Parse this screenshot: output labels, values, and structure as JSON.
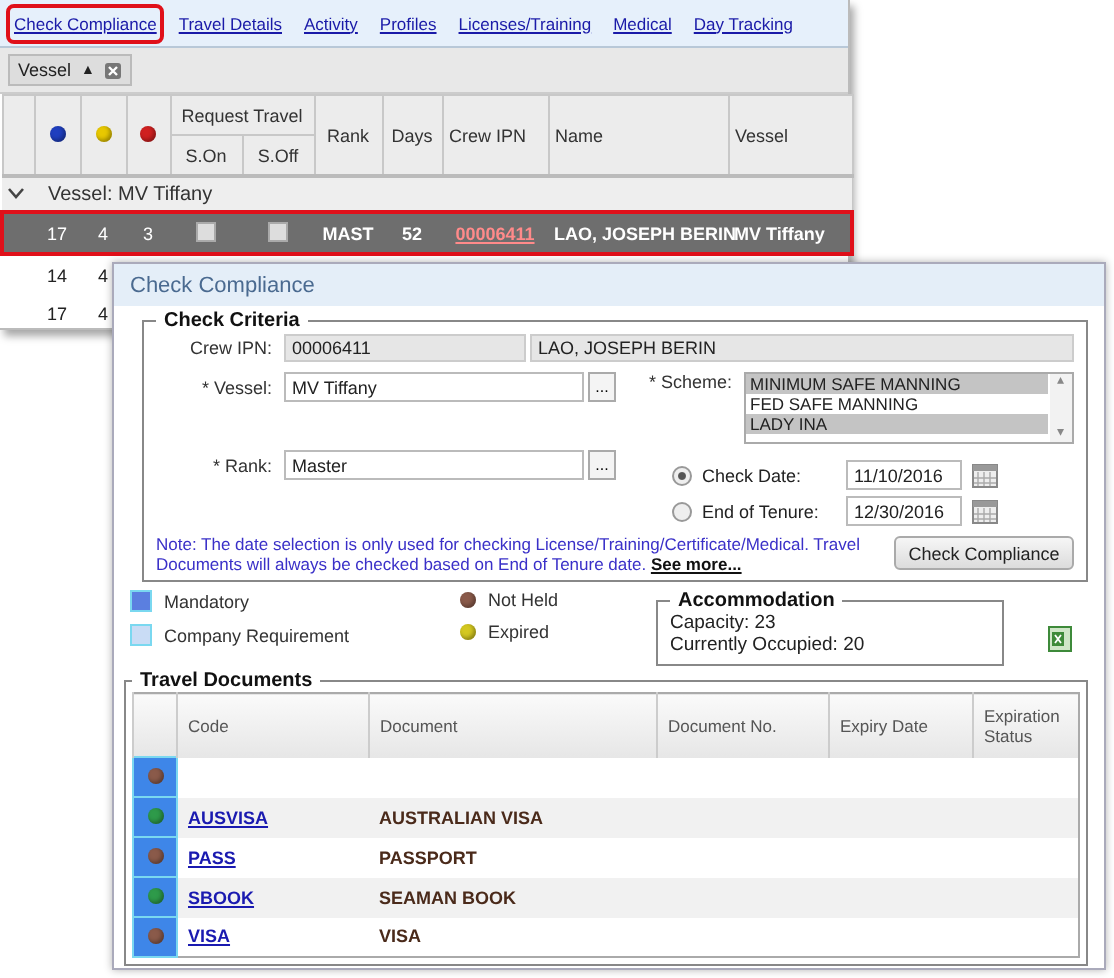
{
  "tabs": [
    {
      "label": "Check Compliance",
      "selected": true
    },
    {
      "label": "Travel Details",
      "selected": false
    },
    {
      "label": "Activity",
      "selected": false
    },
    {
      "label": "Profiles",
      "selected": false
    },
    {
      "label": "Licenses/Training",
      "selected": false
    },
    {
      "label": "Medical",
      "selected": false
    },
    {
      "label": "Day Tracking",
      "selected": false
    }
  ],
  "group_chip": {
    "label": "Vessel",
    "sort": "▲"
  },
  "grid": {
    "status_columns": [
      {
        "color": "#1f3fbf"
      },
      {
        "color": "#e8c800"
      },
      {
        "color": "#d02020"
      }
    ],
    "request_travel": "Request Travel",
    "sub_columns": [
      "S.On",
      "S.Off"
    ],
    "columns": [
      "Rank",
      "Days",
      "Crew IPN",
      "Name",
      "Vessel"
    ],
    "group": {
      "label": "Vessel: MV Tiffany",
      "expanded": true
    },
    "rows": [
      {
        "counts": [
          "17",
          "4",
          "3"
        ],
        "sign_on": false,
        "sign_off": false,
        "rank": "MAST",
        "days": "52",
        "crew_ipn": "00006411",
        "name": "LAO, JOSEPH BERIN",
        "vessel": "MV Tiffany",
        "selected": true
      },
      {
        "counts": [
          "14",
          "4"
        ],
        "selected": false
      },
      {
        "counts": [
          "17",
          "4"
        ],
        "selected": false
      }
    ]
  },
  "dialog": {
    "title": "Check Compliance",
    "criteria": {
      "legend": "Check Criteria",
      "crew_ipn_label": "Crew IPN:",
      "crew_ipn": "00006411",
      "crew_name": "LAO, JOSEPH BERIN",
      "vessel_label": "* Vessel:",
      "vessel": "MV Tiffany",
      "vessel_browse": "...",
      "rank_label": "* Rank:",
      "rank": "Master",
      "rank_browse": "...",
      "scheme_label": "* Scheme:",
      "scroll_up": "▴",
      "scroll_down": "▾",
      "schemes": [
        {
          "label": "MINIMUM SAFE MANNING",
          "selected": true
        },
        {
          "label": "FED SAFE MANNING",
          "selected": false
        },
        {
          "label": "LADY INA",
          "selected": true
        }
      ],
      "date_options": [
        {
          "label": "Check Date:",
          "selected": true,
          "value": "11/10/2016"
        },
        {
          "label": "End of Tenure:",
          "selected": false,
          "value": "12/30/2016"
        }
      ],
      "note": "Note: The date selection is only used for checking License/Training/Certificate/Medical. Travel Documents will always be checked based on End of Tenure date.",
      "see_more": "See more...",
      "button": "Check Compliance"
    },
    "legend_left": [
      {
        "label": "Mandatory",
        "color": "#5b7fe0"
      },
      {
        "label": "Company Requirement",
        "color": "#c9dcf5"
      }
    ],
    "legend_right": [
      {
        "label": "Not Held",
        "color": "#8a5a4a"
      },
      {
        "label": "Expired",
        "color": "#d4c820"
      }
    ],
    "accommodation": {
      "title": "Accommodation",
      "lines": [
        "Capacity: 23",
        "Currently Occupied: 20"
      ]
    },
    "travel_documents": {
      "legend": "Travel Documents",
      "columns": [
        "Code",
        "Document",
        "Document No.",
        "Expiry Date",
        "Expiration Status"
      ],
      "rows": [
        {
          "color": "#8a5a4a"
        },
        {
          "color": "#2e9a4a",
          "code": "AUSVISA",
          "document": "AUSTRALIAN VISA"
        },
        {
          "color": "#8a5a4a",
          "code": "PASS",
          "document": "PASSPORT"
        },
        {
          "color": "#2e9a4a",
          "code": "SBOOK",
          "document": "SEAMAN BOOK"
        },
        {
          "color": "#8a5a4a",
          "code": "VISA",
          "document": "VISA"
        }
      ]
    }
  }
}
